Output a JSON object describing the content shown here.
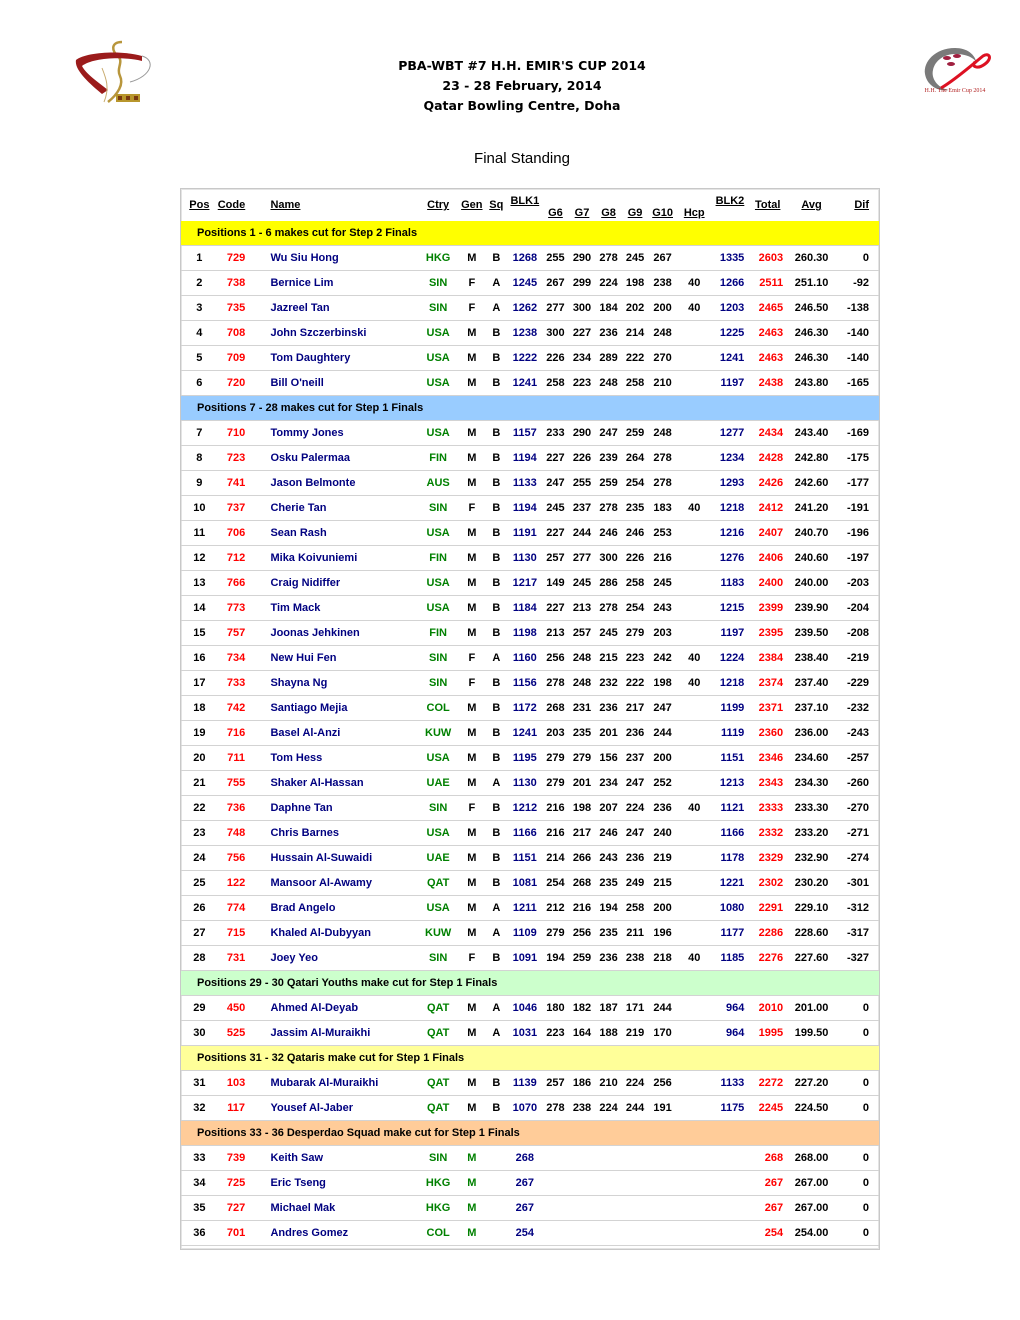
{
  "header": {
    "line1": "PBA-WBT #7 H.H. EMIR'S CUP 2014",
    "line2": "23 - 28 February, 2014",
    "line3": "Qatar Bowling Centre, Doha",
    "subtitle": "Final Standing",
    "right_logo_caption": "H.H. The Emir Cup 2014"
  },
  "colors": {
    "section_yellow": "#ffff00",
    "section_blue": "#99ccff",
    "section_green": "#ccffcc",
    "section_light_yellow": "#ffff99",
    "section_orange": "#ffcc99",
    "code_red": "#ff0000",
    "name_blue": "#000080",
    "country_green": "#008000"
  },
  "columns": {
    "pos": "Pos",
    "code": "Code",
    "name": "Name",
    "ctry": "Ctry",
    "gen": "Gen",
    "sq": "Sq",
    "blk1": "BLK1",
    "g6": "G6",
    "g7": "G7",
    "g8": "G8",
    "g9": "G9",
    "g10": "G10",
    "hcp": "Hcp",
    "blk2": "BLK2",
    "total": "Total",
    "avg": "Avg",
    "dif": "Dif"
  },
  "sections": [
    {
      "title": "Positions 1 - 6 makes cut for Step 2 Finals",
      "color": "#ffff00",
      "rows": [
        {
          "pos": "1",
          "code": "729",
          "name": "Wu Siu Hong",
          "ctry": "HKG",
          "gen": "M",
          "sq": "B",
          "blk1": "1268",
          "g6": "255",
          "g7": "290",
          "g8": "278",
          "g9": "245",
          "g10": "267",
          "hcp": "",
          "blk2": "1335",
          "total": "2603",
          "avg": "260.30",
          "dif": "0"
        },
        {
          "pos": "2",
          "code": "738",
          "name": "Bernice Lim",
          "ctry": "SIN",
          "gen": "F",
          "sq": "A",
          "blk1": "1245",
          "g6": "267",
          "g7": "299",
          "g8": "224",
          "g9": "198",
          "g10": "238",
          "hcp": "40",
          "blk2": "1266",
          "total": "2511",
          "avg": "251.10",
          "dif": "-92"
        },
        {
          "pos": "3",
          "code": "735",
          "name": "Jazreel Tan",
          "ctry": "SIN",
          "gen": "F",
          "sq": "A",
          "blk1": "1262",
          "g6": "277",
          "g7": "300",
          "g8": "184",
          "g9": "202",
          "g10": "200",
          "hcp": "40",
          "blk2": "1203",
          "total": "2465",
          "avg": "246.50",
          "dif": "-138"
        },
        {
          "pos": "4",
          "code": "708",
          "name": "John Szczerbinski",
          "ctry": "USA",
          "gen": "M",
          "sq": "B",
          "blk1": "1238",
          "g6": "300",
          "g7": "227",
          "g8": "236",
          "g9": "214",
          "g10": "248",
          "hcp": "",
          "blk2": "1225",
          "total": "2463",
          "avg": "246.30",
          "dif": "-140"
        },
        {
          "pos": "5",
          "code": "709",
          "name": "Tom Daughtery",
          "ctry": "USA",
          "gen": "M",
          "sq": "B",
          "blk1": "1222",
          "g6": "226",
          "g7": "234",
          "g8": "289",
          "g9": "222",
          "g10": "270",
          "hcp": "",
          "blk2": "1241",
          "total": "2463",
          "avg": "246.30",
          "dif": "-140"
        },
        {
          "pos": "6",
          "code": "720",
          "name": "Bill O'neill",
          "ctry": "USA",
          "gen": "M",
          "sq": "B",
          "blk1": "1241",
          "g6": "258",
          "g7": "223",
          "g8": "248",
          "g9": "258",
          "g10": "210",
          "hcp": "",
          "blk2": "1197",
          "total": "2438",
          "avg": "243.80",
          "dif": "-165"
        }
      ]
    },
    {
      "title": "Positions 7 - 28 makes cut for Step 1 Finals",
      "color": "#99ccff",
      "rows": [
        {
          "pos": "7",
          "code": "710",
          "name": "Tommy Jones",
          "ctry": "USA",
          "gen": "M",
          "sq": "B",
          "blk1": "1157",
          "g6": "233",
          "g7": "290",
          "g8": "247",
          "g9": "259",
          "g10": "248",
          "hcp": "",
          "blk2": "1277",
          "total": "2434",
          "avg": "243.40",
          "dif": "-169"
        },
        {
          "pos": "8",
          "code": "723",
          "name": "Osku Palermaa",
          "ctry": "FIN",
          "gen": "M",
          "sq": "B",
          "blk1": "1194",
          "g6": "227",
          "g7": "226",
          "g8": "239",
          "g9": "264",
          "g10": "278",
          "hcp": "",
          "blk2": "1234",
          "total": "2428",
          "avg": "242.80",
          "dif": "-175"
        },
        {
          "pos": "9",
          "code": "741",
          "name": "Jason Belmonte",
          "ctry": "AUS",
          "gen": "M",
          "sq": "B",
          "blk1": "1133",
          "g6": "247",
          "g7": "255",
          "g8": "259",
          "g9": "254",
          "g10": "278",
          "hcp": "",
          "blk2": "1293",
          "total": "2426",
          "avg": "242.60",
          "dif": "-177"
        },
        {
          "pos": "10",
          "code": "737",
          "name": "Cherie Tan",
          "ctry": "SIN",
          "gen": "F",
          "sq": "B",
          "blk1": "1194",
          "g6": "245",
          "g7": "237",
          "g8": "278",
          "g9": "235",
          "g10": "183",
          "hcp": "40",
          "blk2": "1218",
          "total": "2412",
          "avg": "241.20",
          "dif": "-191"
        },
        {
          "pos": "11",
          "code": "706",
          "name": "Sean Rash",
          "ctry": "USA",
          "gen": "M",
          "sq": "B",
          "blk1": "1191",
          "g6": "227",
          "g7": "244",
          "g8": "246",
          "g9": "246",
          "g10": "253",
          "hcp": "",
          "blk2": "1216",
          "total": "2407",
          "avg": "240.70",
          "dif": "-196"
        },
        {
          "pos": "12",
          "code": "712",
          "name": "Mika Koivuniemi",
          "ctry": "FIN",
          "gen": "M",
          "sq": "B",
          "blk1": "1130",
          "g6": "257",
          "g7": "277",
          "g8": "300",
          "g9": "226",
          "g10": "216",
          "hcp": "",
          "blk2": "1276",
          "total": "2406",
          "avg": "240.60",
          "dif": "-197"
        },
        {
          "pos": "13",
          "code": "766",
          "name": "Craig Nidiffer",
          "ctry": "USA",
          "gen": "M",
          "sq": "B",
          "blk1": "1217",
          "g6": "149",
          "g7": "245",
          "g8": "286",
          "g9": "258",
          "g10": "245",
          "hcp": "",
          "blk2": "1183",
          "total": "2400",
          "avg": "240.00",
          "dif": "-203"
        },
        {
          "pos": "14",
          "code": "773",
          "name": "Tim Mack",
          "ctry": "USA",
          "gen": "M",
          "sq": "B",
          "blk1": "1184",
          "g6": "227",
          "g7": "213",
          "g8": "278",
          "g9": "254",
          "g10": "243",
          "hcp": "",
          "blk2": "1215",
          "total": "2399",
          "avg": "239.90",
          "dif": "-204"
        },
        {
          "pos": "15",
          "code": "757",
          "name": "Joonas Jehkinen",
          "ctry": "FIN",
          "gen": "M",
          "sq": "B",
          "blk1": "1198",
          "g6": "213",
          "g7": "257",
          "g8": "245",
          "g9": "279",
          "g10": "203",
          "hcp": "",
          "blk2": "1197",
          "total": "2395",
          "avg": "239.50",
          "dif": "-208"
        },
        {
          "pos": "16",
          "code": "734",
          "name": "New Hui Fen",
          "ctry": "SIN",
          "gen": "F",
          "sq": "A",
          "blk1": "1160",
          "g6": "256",
          "g7": "248",
          "g8": "215",
          "g9": "223",
          "g10": "242",
          "hcp": "40",
          "blk2": "1224",
          "total": "2384",
          "avg": "238.40",
          "dif": "-219"
        },
        {
          "pos": "17",
          "code": "733",
          "name": "Shayna Ng",
          "ctry": "SIN",
          "gen": "F",
          "sq": "B",
          "blk1": "1156",
          "g6": "278",
          "g7": "248",
          "g8": "232",
          "g9": "222",
          "g10": "198",
          "hcp": "40",
          "blk2": "1218",
          "total": "2374",
          "avg": "237.40",
          "dif": "-229"
        },
        {
          "pos": "18",
          "code": "742",
          "name": "Santiago Mejia",
          "ctry": "COL",
          "gen": "M",
          "sq": "B",
          "blk1": "1172",
          "g6": "268",
          "g7": "231",
          "g8": "236",
          "g9": "217",
          "g10": "247",
          "hcp": "",
          "blk2": "1199",
          "total": "2371",
          "avg": "237.10",
          "dif": "-232"
        },
        {
          "pos": "19",
          "code": "716",
          "name": "Basel Al-Anzi",
          "ctry": "KUW",
          "gen": "M",
          "sq": "B",
          "blk1": "1241",
          "g6": "203",
          "g7": "235",
          "g8": "201",
          "g9": "236",
          "g10": "244",
          "hcp": "",
          "blk2": "1119",
          "total": "2360",
          "avg": "236.00",
          "dif": "-243"
        },
        {
          "pos": "20",
          "code": "711",
          "name": "Tom Hess",
          "ctry": "USA",
          "gen": "M",
          "sq": "B",
          "blk1": "1195",
          "g6": "279",
          "g7": "279",
          "g8": "156",
          "g9": "237",
          "g10": "200",
          "hcp": "",
          "blk2": "1151",
          "total": "2346",
          "avg": "234.60",
          "dif": "-257"
        },
        {
          "pos": "21",
          "code": "755",
          "name": "Shaker Al-Hassan",
          "ctry": "UAE",
          "gen": "M",
          "sq": "A",
          "blk1": "1130",
          "g6": "279",
          "g7": "201",
          "g8": "234",
          "g9": "247",
          "g10": "252",
          "hcp": "",
          "blk2": "1213",
          "total": "2343",
          "avg": "234.30",
          "dif": "-260"
        },
        {
          "pos": "22",
          "code": "736",
          "name": "Daphne Tan",
          "ctry": "SIN",
          "gen": "F",
          "sq": "B",
          "blk1": "1212",
          "g6": "216",
          "g7": "198",
          "g8": "207",
          "g9": "224",
          "g10": "236",
          "hcp": "40",
          "blk2": "1121",
          "total": "2333",
          "avg": "233.30",
          "dif": "-270"
        },
        {
          "pos": "23",
          "code": "748",
          "name": "Chris Barnes",
          "ctry": "USA",
          "gen": "M",
          "sq": "B",
          "blk1": "1166",
          "g6": "216",
          "g7": "217",
          "g8": "246",
          "g9": "247",
          "g10": "240",
          "hcp": "",
          "blk2": "1166",
          "total": "2332",
          "avg": "233.20",
          "dif": "-271"
        },
        {
          "pos": "24",
          "code": "756",
          "name": "Hussain Al-Suwaidi",
          "ctry": "UAE",
          "gen": "M",
          "sq": "B",
          "blk1": "1151",
          "g6": "214",
          "g7": "266",
          "g8": "243",
          "g9": "236",
          "g10": "219",
          "hcp": "",
          "blk2": "1178",
          "total": "2329",
          "avg": "232.90",
          "dif": "-274"
        },
        {
          "pos": "25",
          "code": "122",
          "name": "Mansoor Al-Awamy",
          "ctry": "QAT",
          "gen": "M",
          "sq": "B",
          "blk1": "1081",
          "g6": "254",
          "g7": "268",
          "g8": "235",
          "g9": "249",
          "g10": "215",
          "hcp": "",
          "blk2": "1221",
          "total": "2302",
          "avg": "230.20",
          "dif": "-301"
        },
        {
          "pos": "26",
          "code": "774",
          "name": "Brad Angelo",
          "ctry": "USA",
          "gen": "M",
          "sq": "A",
          "blk1": "1211",
          "g6": "212",
          "g7": "216",
          "g8": "194",
          "g9": "258",
          "g10": "200",
          "hcp": "",
          "blk2": "1080",
          "total": "2291",
          "avg": "229.10",
          "dif": "-312"
        },
        {
          "pos": "27",
          "code": "715",
          "name": "Khaled Al-Dubyyan",
          "ctry": "KUW",
          "gen": "M",
          "sq": "A",
          "blk1": "1109",
          "g6": "279",
          "g7": "256",
          "g8": "235",
          "g9": "211",
          "g10": "196",
          "hcp": "",
          "blk2": "1177",
          "total": "2286",
          "avg": "228.60",
          "dif": "-317"
        },
        {
          "pos": "28",
          "code": "731",
          "name": "Joey Yeo",
          "ctry": "SIN",
          "gen": "F",
          "sq": "B",
          "blk1": "1091",
          "g6": "194",
          "g7": "259",
          "g8": "236",
          "g9": "238",
          "g10": "218",
          "hcp": "40",
          "blk2": "1185",
          "total": "2276",
          "avg": "227.60",
          "dif": "-327"
        }
      ]
    },
    {
      "title": "Positions 29 - 30 Qatari Youths make cut for Step 1 Finals",
      "color": "#ccffcc",
      "rows": [
        {
          "pos": "29",
          "code": "450",
          "name": "Ahmed Al-Deyab",
          "ctry": "QAT",
          "gen": "M",
          "sq": "A",
          "blk1": "1046",
          "g6": "180",
          "g7": "182",
          "g8": "187",
          "g9": "171",
          "g10": "244",
          "hcp": "",
          "blk2": "964",
          "total": "2010",
          "avg": "201.00",
          "dif": "0"
        },
        {
          "pos": "30",
          "code": "525",
          "name": "Jassim Al-Muraikhi",
          "ctry": "QAT",
          "gen": "M",
          "sq": "A",
          "blk1": "1031",
          "g6": "223",
          "g7": "164",
          "g8": "188",
          "g9": "219",
          "g10": "170",
          "hcp": "",
          "blk2": "964",
          "total": "1995",
          "avg": "199.50",
          "dif": "0"
        }
      ]
    },
    {
      "title": "Positions 31 - 32 Qataris make cut for Step 1 Finals",
      "color": "#ffff99",
      "rows": [
        {
          "pos": "31",
          "code": "103",
          "name": "Mubarak Al-Muraikhi",
          "ctry": "QAT",
          "gen": "M",
          "sq": "B",
          "blk1": "1139",
          "g6": "257",
          "g7": "186",
          "g8": "210",
          "g9": "224",
          "g10": "256",
          "hcp": "",
          "blk2": "1133",
          "total": "2272",
          "avg": "227.20",
          "dif": "0"
        },
        {
          "pos": "32",
          "code": "117",
          "name": "Yousef Al-Jaber",
          "ctry": "QAT",
          "gen": "M",
          "sq": "B",
          "blk1": "1070",
          "g6": "278",
          "g7": "238",
          "g8": "224",
          "g9": "244",
          "g10": "191",
          "hcp": "",
          "blk2": "1175",
          "total": "2245",
          "avg": "224.50",
          "dif": "0"
        }
      ]
    },
    {
      "title": "Positions 33 - 36 Desperdao Squad make cut for Step 1 Finals",
      "color": "#ffcc99",
      "rows": [
        {
          "pos": "33",
          "code": "739",
          "name": "Keith Saw",
          "ctry": "SIN",
          "gen": "M",
          "sq": "",
          "blk1": "268",
          "g6": "",
          "g7": "",
          "g8": "",
          "g9": "",
          "g10": "",
          "hcp": "",
          "blk2": "",
          "total": "268",
          "avg": "268.00",
          "dif": "0",
          "gen_green": true
        },
        {
          "pos": "34",
          "code": "725",
          "name": "Eric Tseng",
          "ctry": "HKG",
          "gen": "M",
          "sq": "",
          "blk1": "267",
          "g6": "",
          "g7": "",
          "g8": "",
          "g9": "",
          "g10": "",
          "hcp": "",
          "blk2": "",
          "total": "267",
          "avg": "267.00",
          "dif": "0",
          "gen_green": true
        },
        {
          "pos": "35",
          "code": "727",
          "name": "Michael Mak",
          "ctry": "HKG",
          "gen": "M",
          "sq": "",
          "blk1": "267",
          "g6": "",
          "g7": "",
          "g8": "",
          "g9": "",
          "g10": "",
          "hcp": "",
          "blk2": "",
          "total": "267",
          "avg": "267.00",
          "dif": "0",
          "gen_green": true
        },
        {
          "pos": "36",
          "code": "701",
          "name": "Andres Gomez",
          "ctry": "COL",
          "gen": "M",
          "sq": "",
          "blk1": "254",
          "g6": "",
          "g7": "",
          "g8": "",
          "g9": "",
          "g10": "",
          "hcp": "",
          "blk2": "",
          "total": "254",
          "avg": "254.00",
          "dif": "0",
          "gen_green": true
        }
      ]
    }
  ]
}
